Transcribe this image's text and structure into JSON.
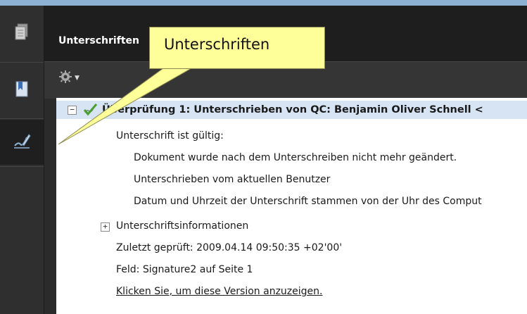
{
  "panel": {
    "title": "Unterschriften"
  },
  "callout": {
    "text": "Unterschriften"
  },
  "signature": {
    "title": "Überprüfung 1: Unterschrieben von QC: Benjamin Oliver Schnell <",
    "status": "Unterschrift ist gültig:",
    "details": [
      "Dokument wurde nach dem Unterschreiben nicht mehr geändert.",
      "Unterschrieben vom aktuellen Benutzer",
      "Datum und Uhrzeit der Unterschrift stammen von der Uhr des Comput"
    ],
    "info_label": "Unterschriftsinformationen",
    "last_checked": "Zuletzt geprüft: 2009.04.14 09:50:35 +02'00'",
    "field": "Feld: Signature2 auf Seite 1",
    "view_link": "Klicken Sie, um diese Version anzuzeigen."
  },
  "icons": {
    "sidebar": [
      "pages-icon",
      "bookmarks-icon",
      "signatures-icon"
    ],
    "options": "gear-icon",
    "signature": "valid-signature-icon"
  },
  "colors": {
    "callout_bg": "#ffff9a",
    "panel_header_bg": "#1e1e1e",
    "selected_row_bg": "#d6e4f3"
  }
}
